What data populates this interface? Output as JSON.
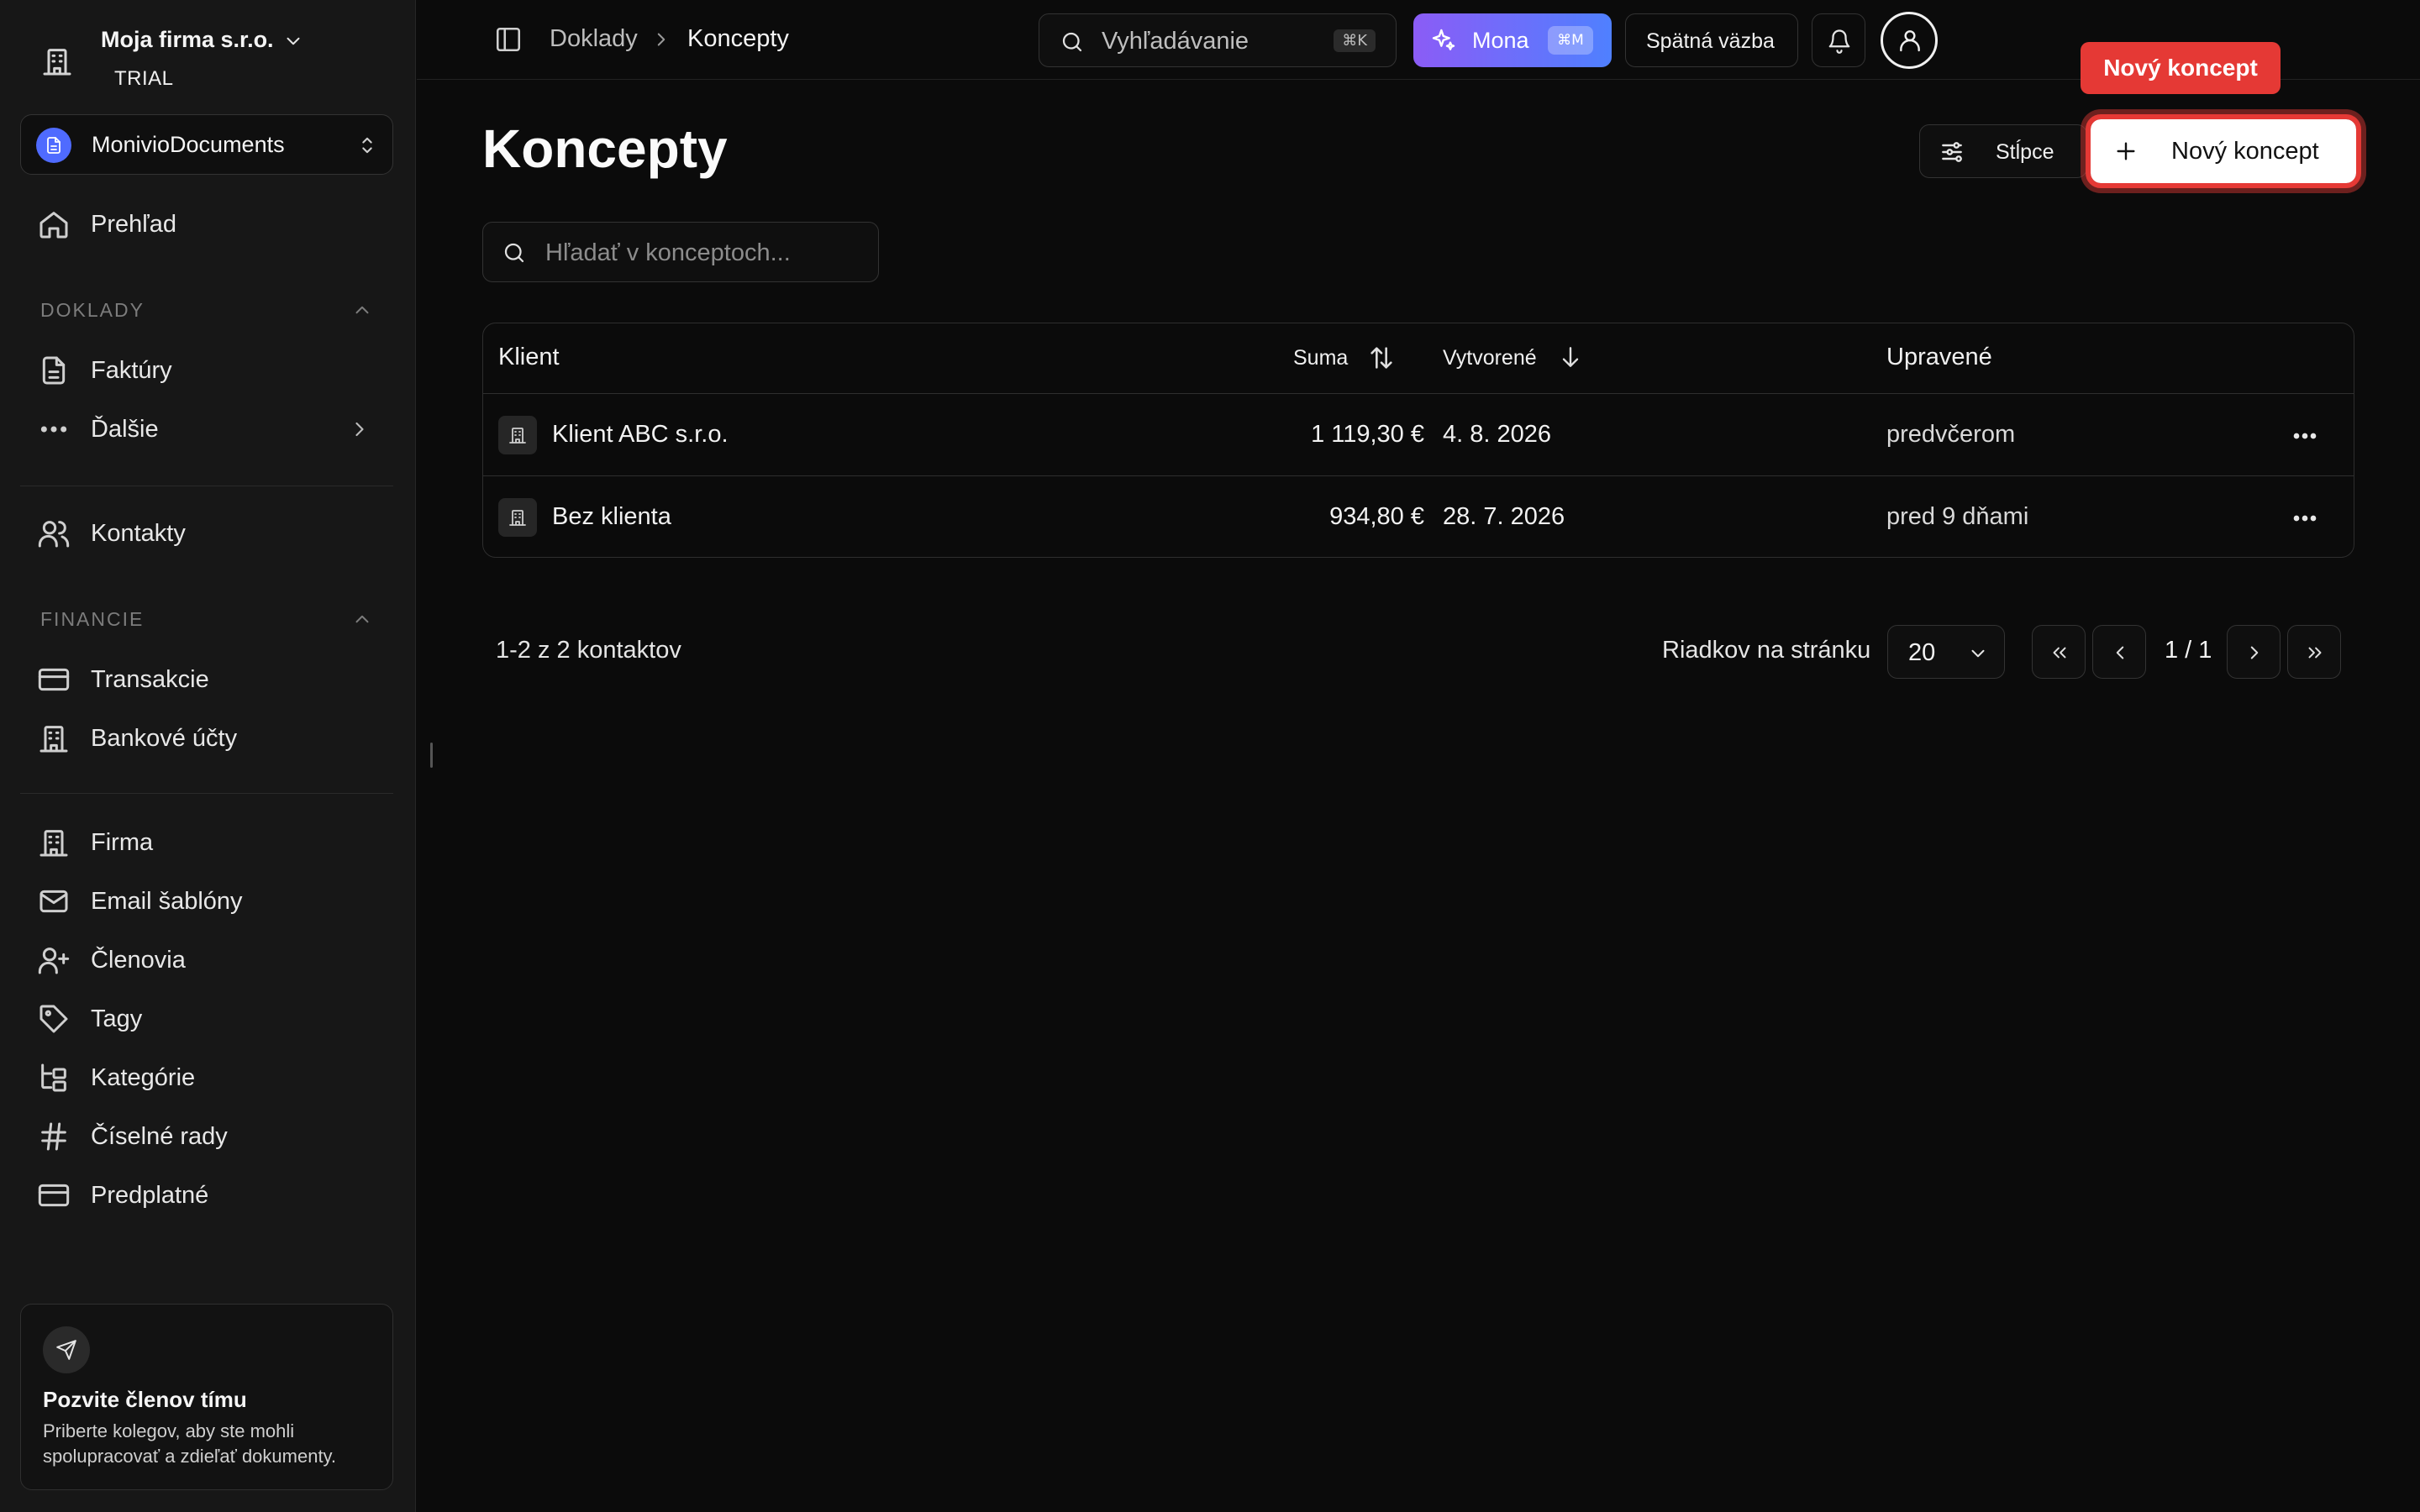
{
  "org": {
    "name": "Moja firma s.r.o.",
    "plan": "TRIAL"
  },
  "app": {
    "name": "MonivioDocuments"
  },
  "sidebar": {
    "overview": "Prehľad",
    "sections": {
      "documents": "DOKLADY",
      "finance": "FINANCIE"
    },
    "items": {
      "invoices": "Faktúry",
      "more": "Ďalšie",
      "contacts": "Kontakty",
      "transactions": "Transakcie",
      "bank_accounts": "Bankové účty",
      "company": "Firma",
      "email_templates": "Email šablóny",
      "members": "Členovia",
      "tags": "Tagy",
      "categories": "Kategórie",
      "number_series": "Číselné rady",
      "subscription": "Predplatné"
    },
    "invite": {
      "title": "Pozvite členov tímu",
      "text": "Priberte kolegov, aby ste mohli spolupracovať a zdieľať dokumenty."
    }
  },
  "header": {
    "breadcrumb": [
      "Doklady",
      "Koncepty"
    ],
    "search_placeholder": "Vyhľadávanie",
    "search_shortcut": "⌘K",
    "mona_label": "Mona",
    "mona_shortcut": "⌘M",
    "feedback_label": "Spätná väzba"
  },
  "main": {
    "title": "Koncepty",
    "columns_label": "Stĺpce",
    "new_label": "Nový koncept",
    "tooltip": "Nový koncept",
    "search_placeholder": "Hľadať v konceptoch...",
    "table": {
      "headers": {
        "client": "Klient",
        "sum": "Suma",
        "created": "Vytvorené",
        "updated": "Upravené"
      },
      "rows": [
        {
          "client": "Klient ABC s.r.o.",
          "sum": "1 119,30 €",
          "created": "4. 8. 2026",
          "updated": "predvčerom"
        },
        {
          "client": "Bez klienta",
          "sum": "934,80 €",
          "created": "28. 7. 2026",
          "updated": "pred 9 dňami"
        }
      ]
    },
    "pagination": {
      "info": "1-2 z 2 kontaktov",
      "rows_per_page_label": "Riadkov na stránku",
      "rows_per_page": "20",
      "page": "1 / 1"
    }
  },
  "colors": {
    "accent": "#e53935",
    "mona_from": "#8b5cf6",
    "mona_to": "#4f80ff",
    "app_icon": "#4f6bff"
  }
}
